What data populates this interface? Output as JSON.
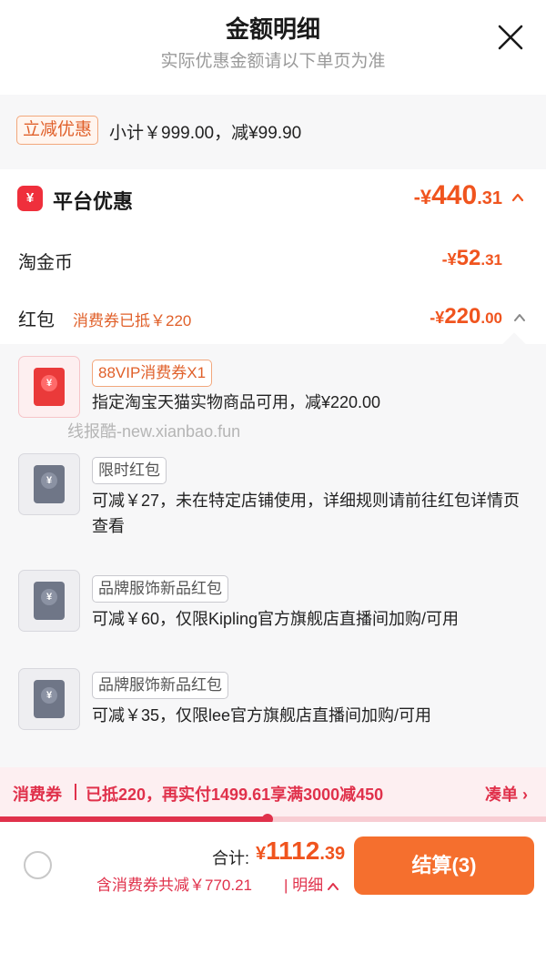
{
  "header": {
    "title": "金额明细",
    "subtitle": "实际优惠金额请以下单页为准"
  },
  "instant_discount": {
    "tag": "立减优惠",
    "text": "小计￥999.00，减¥99.90"
  },
  "platform": {
    "icon_glyph": "¥",
    "title": "平台优惠",
    "amount": {
      "sign": "-¥",
      "int": "440",
      "dec": ".31"
    },
    "taojinbi": {
      "label": "淘金币",
      "amount": {
        "sign": "-¥",
        "int": "52",
        "dec": ".31"
      }
    },
    "hongbao": {
      "label": "红包",
      "note": "消费券已抵￥220",
      "amount": {
        "sign": "-¥",
        "int": "220",
        "dec": ".00"
      }
    }
  },
  "coupons": [
    {
      "tag": "88VIP消费券X1",
      "desc": "指定淘宝天猫实物商品可用，减¥220.00",
      "style": "red",
      "icon_glyph": "¥"
    },
    {
      "tag": "限时红包",
      "desc": "可减￥27，未在特定店铺使用，详细规则请前往红包详情页查看",
      "style": "grey",
      "icon_glyph": "¥"
    },
    {
      "tag": "品牌服饰新品红包",
      "desc": "可减￥60，仅限Kipling官方旗舰店直播间加购/可用",
      "style": "grey",
      "icon_glyph": "¥"
    },
    {
      "tag": "品牌服饰新品红包",
      "desc": "可减￥35，仅限lee官方旗舰店直播间加购/可用",
      "style": "grey",
      "icon_glyph": "¥"
    }
  ],
  "watermark": "线报酷-new.xianbao.fun",
  "promo": {
    "label": "消费券",
    "text": "已抵220，再实付1499.61享满3000减450",
    "link": "凑单 ›",
    "progress_fraction": 0.49
  },
  "footer": {
    "total_label": "合计:",
    "total": {
      "sign": "¥",
      "int": "1112",
      "dec": ".39"
    },
    "savings": "含消费券共减￥770.21",
    "detail": "明细",
    "checkout": "结算(3)"
  },
  "colors": {
    "accent_orange": "#f0541e",
    "promo_red": "#e0314b",
    "checkout_bg": "#f56f2e"
  }
}
